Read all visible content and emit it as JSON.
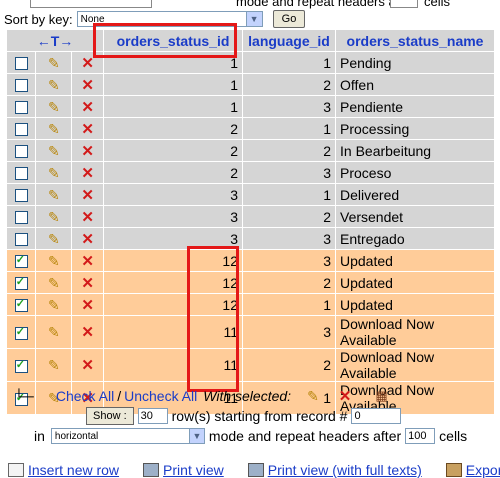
{
  "top": {
    "select_value": "",
    "text": "mode and repeat headers after",
    "input_value": "",
    "text2": "cells"
  },
  "sort": {
    "label": "Sort by key:",
    "select_value": "None",
    "go_label": "Go"
  },
  "table": {
    "nav_arrows": "←T→",
    "columns": [
      "orders_status_id",
      "language_id",
      "orders_status_name"
    ],
    "rows": [
      {
        "id": "1",
        "lang": "1",
        "name": "Pending",
        "checked": false,
        "highlight": false
      },
      {
        "id": "1",
        "lang": "2",
        "name": "Offen",
        "checked": false,
        "highlight": false
      },
      {
        "id": "1",
        "lang": "3",
        "name": "Pendiente",
        "checked": false,
        "highlight": false
      },
      {
        "id": "2",
        "lang": "1",
        "name": "Processing",
        "checked": false,
        "highlight": false
      },
      {
        "id": "2",
        "lang": "2",
        "name": "In Bearbeitung",
        "checked": false,
        "highlight": false
      },
      {
        "id": "2",
        "lang": "3",
        "name": "Proceso",
        "checked": false,
        "highlight": false
      },
      {
        "id": "3",
        "lang": "1",
        "name": "Delivered",
        "checked": false,
        "highlight": false
      },
      {
        "id": "3",
        "lang": "2",
        "name": "Versendet",
        "checked": false,
        "highlight": false
      },
      {
        "id": "3",
        "lang": "3",
        "name": "Entregado",
        "checked": false,
        "highlight": false
      },
      {
        "id": "12",
        "lang": "3",
        "name": "Updated",
        "checked": true,
        "highlight": true
      },
      {
        "id": "12",
        "lang": "2",
        "name": "Updated",
        "checked": true,
        "highlight": true
      },
      {
        "id": "12",
        "lang": "1",
        "name": "Updated",
        "checked": true,
        "highlight": true
      },
      {
        "id": "11",
        "lang": "3",
        "name": "Download Now Available",
        "checked": true,
        "highlight": true
      },
      {
        "id": "11",
        "lang": "2",
        "name": "Download Now Available",
        "checked": true,
        "highlight": true
      },
      {
        "id": "11",
        "lang": "1",
        "name": "Download Now Available",
        "checked": true,
        "highlight": true
      }
    ]
  },
  "footer": {
    "check_all": "Check All",
    "separator": "/",
    "uncheck_all": "Uncheck All",
    "with_selected": "With selected:",
    "show_label": "Show :",
    "show_rows": "30",
    "rows_text": "row(s) starting from record #",
    "start_record": "0",
    "in_label": "in",
    "mode_value": "horizontal",
    "mode_text": "mode and repeat headers after",
    "repeat_value": "100",
    "cells_text": "cells"
  },
  "links": {
    "insert": "Insert new row",
    "print": "Print view",
    "print_full": "Print view (with full texts)",
    "export": "Export"
  },
  "colors": {
    "header_bg": "#d5d5d5",
    "row_bg": "#d5d5d5",
    "highlight_bg": "#ffcc99",
    "link": "#1a3cc8",
    "annotation": "#e41818"
  }
}
